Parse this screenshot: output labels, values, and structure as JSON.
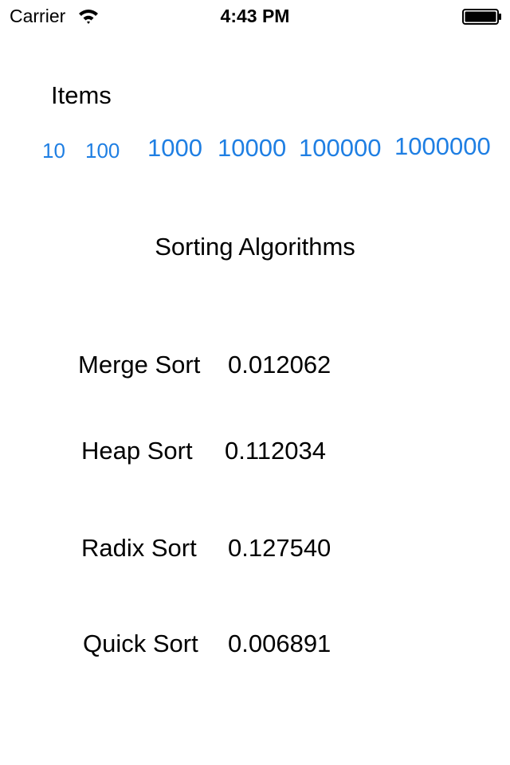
{
  "status_bar": {
    "carrier": "Carrier",
    "time": "4:43 PM",
    "wifi_icon": "wifi-icon",
    "battery_icon": "battery-icon"
  },
  "items_section": {
    "title": "Items",
    "options": [
      "10",
      "100",
      "1000",
      "10000",
      "100000",
      "1000000"
    ],
    "link_color": "#1f7fe3"
  },
  "algorithms_section": {
    "heading": "Sorting Algorithms",
    "results": [
      {
        "name": "Merge Sort",
        "time": "0.012062"
      },
      {
        "name": "Heap Sort",
        "time": "0.112034"
      },
      {
        "name": "Radix Sort",
        "time": "0.127540"
      },
      {
        "name": "Quick Sort",
        "time": "0.006891"
      }
    ]
  }
}
